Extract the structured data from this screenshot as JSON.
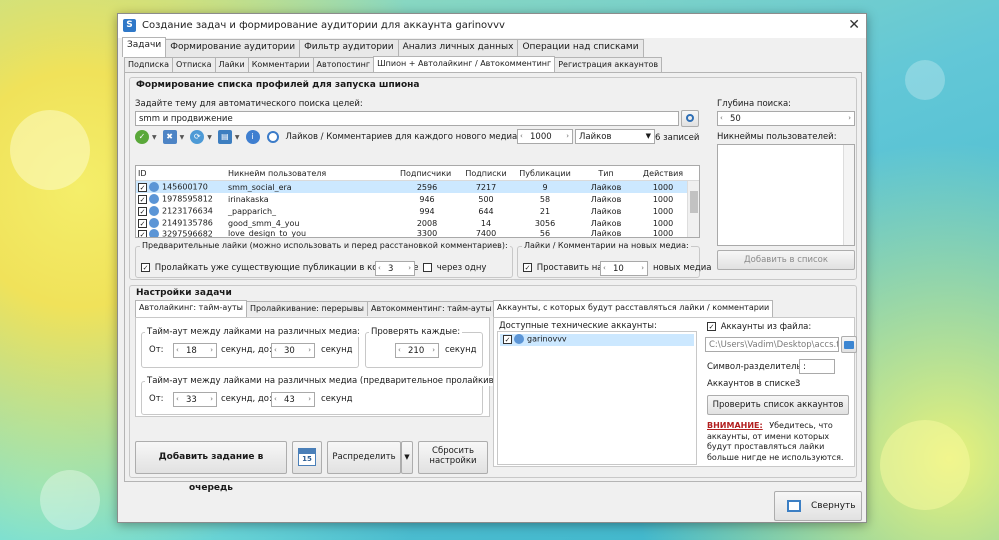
{
  "window": {
    "title": "Создание задач и формирование аудитории для аккаунта garinovvv",
    "close": "✕"
  },
  "tabs_main": [
    "Задачи",
    "Формирование аудитории",
    "Фильтр аудитории",
    "Анализ личных данных",
    "Операции над списками"
  ],
  "tabs_sub": [
    "Подписка",
    "Отписка",
    "Лайки",
    "Комментарии",
    "Автопостинг",
    "Шпион + Автолайкинг / Автокомментинг",
    "Регистрация аккаунтов"
  ],
  "spy": {
    "group_title": "Формирование списка профилей для запуска шпиона",
    "topic_label": "Задайте тему для автоматического поиска целей:",
    "topic_value": "smm и продвижение",
    "depth_label": "Глубина поиска:",
    "depth_value": "50",
    "nicknames_label": "Никнеймы пользователей:",
    "add_to_list": "Добавить в список",
    "toolbar_text": "Лайков / Комментариев для каждого нового медиа:",
    "per_media_value": "1000",
    "type_select": "Лайков",
    "records": "6 записей",
    "columns": [
      "ID",
      "Никнейм пользователя",
      "Подписчики",
      "Подписки",
      "Публикации",
      "Тип",
      "Действия"
    ],
    "rows": [
      {
        "id": "145600170",
        "nick": "smm_social_era",
        "followers": "2596",
        "following": "7217",
        "posts": "9",
        "type": "Лайков",
        "actions": "1000"
      },
      {
        "id": "1978595812",
        "nick": "irinakaska",
        "followers": "946",
        "following": "500",
        "posts": "58",
        "type": "Лайков",
        "actions": "1000"
      },
      {
        "id": "2123176634",
        "nick": "_papparich_",
        "followers": "994",
        "following": "644",
        "posts": "21",
        "type": "Лайков",
        "actions": "1000"
      },
      {
        "id": "2149135786",
        "nick": "good_smm_4_you",
        "followers": "2008",
        "following": "14",
        "posts": "3056",
        "type": "Лайков",
        "actions": "1000"
      },
      {
        "id": "3297596682",
        "nick": "love_design_to_you",
        "followers": "3300",
        "following": "7400",
        "posts": "56",
        "type": "Лайков",
        "actions": "1000"
      }
    ],
    "prelike_group": "Предварительные лайки (можно использовать и перед расстановкой комментариев):",
    "prelike_check": "Пролайкать уже существующие публикации в количестве",
    "prelike_value": "3",
    "prelike_through": "через одну",
    "newmedia_group": "Лайки / Комментарии на новых медиа:",
    "newmedia_check": "Проставить на",
    "newmedia_value": "10",
    "newmedia_suffix": "новых медиа"
  },
  "settings": {
    "group_title": "Настройки задачи",
    "tabs": [
      "Автолайкинг: тайм-ауты",
      "Пролайкивание: перерывы",
      "Автокомментинг: тайм-ауты"
    ],
    "timeout_group": "Тайм-аут между лайками на различных медиа:",
    "from_label": "От:",
    "from_value": "18",
    "sec_to": "секунд, до:",
    "to_value": "30",
    "seconds": "секунд",
    "check_group": "Проверять каждые:",
    "check_value": "210",
    "timeout2_group": "Тайм-аут между лайками на различных медиа (предварительное пролайкивание):",
    "from2_value": "33",
    "to2_value": "43",
    "add_task": "Добавить задание в очередь",
    "calendar_num": "15",
    "distribute": "Распределить",
    "reset": "Сбросить настройки"
  },
  "accounts": {
    "tab_title": "Аккаунты, с которых будут расставляться лайки / комментарии",
    "available_label": "Доступные технические аккаунты:",
    "list": [
      "garinovvv"
    ],
    "from_file_label": "Аккаунты из файла:",
    "file_path": "C:\\Users\\Vadim\\Desktop\\accs.t",
    "separator_label": "Символ-разделитель:",
    "separator_value": ":",
    "count_label": "Аккаунтов в списке:",
    "count_value": "3",
    "check_btn": "Проверить список аккаунтов",
    "warning_title": "ВНИМАНИЕ:",
    "warning_text": "Убедитесь, что аккаунты, от имени которых будут проставляться лайки больше нигде не используются."
  },
  "footer": {
    "collapse": "Свернуть"
  }
}
